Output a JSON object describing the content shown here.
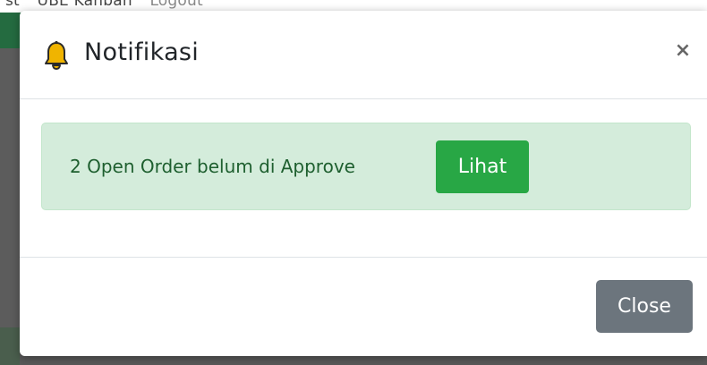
{
  "background": {
    "nav_items": [
      "st",
      "UBE Kanban",
      "Logout"
    ]
  },
  "modal": {
    "title": "Notifikasi",
    "title_icon": "bell-icon",
    "close_glyph": "×",
    "alert": {
      "message": "2 Open Order belum di Approve",
      "action_label": "Lihat"
    },
    "footer": {
      "close_label": "Close"
    }
  },
  "colors": {
    "bell": "#f0b400",
    "alert_bg": "#d4ecdb",
    "alert_text": "#1e5f2f",
    "success_button": "#28a745",
    "secondary_button": "#6c757d",
    "header_green": "#246b40"
  }
}
